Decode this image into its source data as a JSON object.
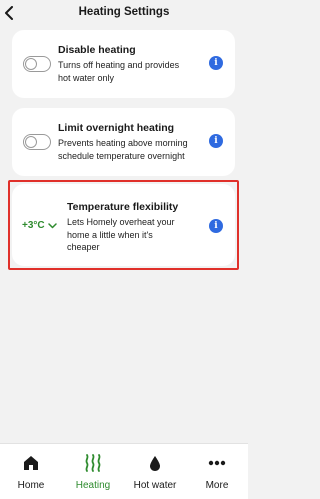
{
  "header": {
    "title": "Heating Settings",
    "back_icon": "chevron-left-icon"
  },
  "cards": [
    {
      "title": "Disable heating",
      "description_lines": [
        "Turns off heating and provides",
        "hot water only"
      ],
      "toggle_on": false,
      "info_icon": "info-icon"
    },
    {
      "title": "Limit overnight heating",
      "description_lines": [
        "Prevents heating above morning",
        "schedule temperature overnight"
      ],
      "toggle_on": false,
      "info_icon": "info-icon"
    },
    {
      "title": "Temperature flexibility",
      "description_lines": [
        "Lets Homely overheat your",
        "home a little when it's",
        "cheaper"
      ],
      "selected_value": "+3°C",
      "info_icon": "info-icon",
      "highlighted": true
    }
  ],
  "info_glyph": "i",
  "nav": {
    "items": [
      {
        "label": "Home",
        "icon": "home-icon",
        "active": false
      },
      {
        "label": "Heating",
        "icon": "heating-icon",
        "active": true
      },
      {
        "label": "Hot water",
        "icon": "water-drop-icon",
        "active": false
      },
      {
        "label": "More",
        "icon": "more-icon",
        "active": false
      }
    ]
  },
  "colors": {
    "accent_green": "#2e8b2e",
    "info_blue": "#2f6ae0",
    "highlight_red": "#e0302a",
    "background": "#f2f2f2"
  }
}
